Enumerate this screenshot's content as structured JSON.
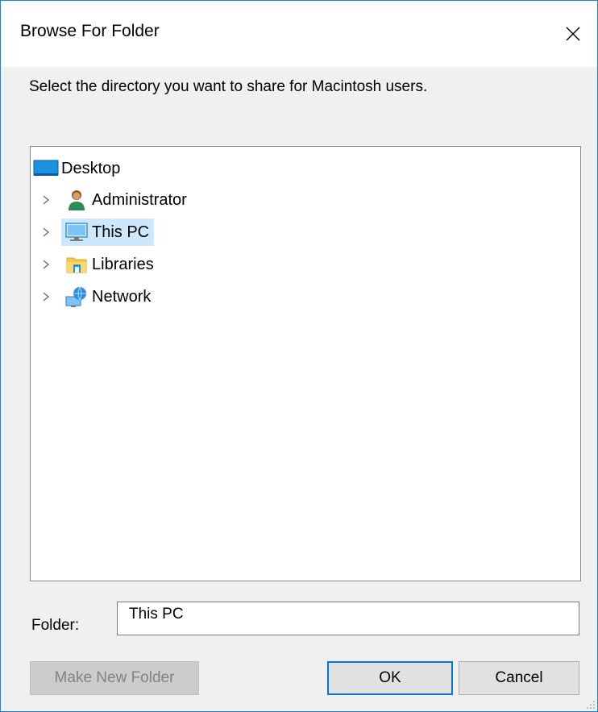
{
  "window": {
    "title": "Browse For Folder",
    "close_glyph": "✕"
  },
  "instruction": "Select the directory you want to share for Macintosh users.",
  "tree": {
    "root": {
      "label": "Desktop",
      "icon": "desktop-icon"
    },
    "children": [
      {
        "label": "Administrator",
        "icon": "user-icon",
        "expander": "›"
      },
      {
        "label": "This PC",
        "icon": "computer-icon",
        "expander": "›",
        "selected": true
      },
      {
        "label": "Libraries",
        "icon": "libraries-icon",
        "expander": "›"
      },
      {
        "label": "Network",
        "icon": "network-icon",
        "expander": "›"
      }
    ]
  },
  "folder": {
    "label": "Folder:",
    "value": "This PC"
  },
  "buttons": {
    "make_new_folder": "Make New Folder",
    "ok": "OK",
    "cancel": "Cancel"
  },
  "colors": {
    "accent": "#0078d7",
    "selection": "#cce8ff",
    "window_border": "#1883d7"
  }
}
